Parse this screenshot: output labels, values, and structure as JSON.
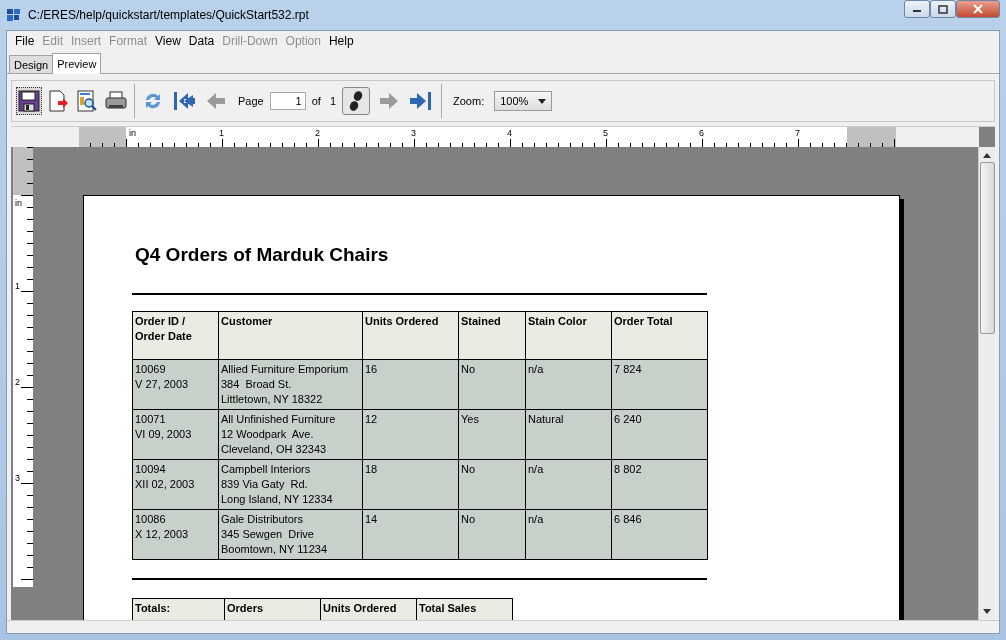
{
  "window": {
    "title": "C:/ERES/help/quickstart/templates/QuickStart532.rpt"
  },
  "menu": [
    {
      "label": "File",
      "disabled": false
    },
    {
      "label": "Edit",
      "disabled": true
    },
    {
      "label": "Insert",
      "disabled": true
    },
    {
      "label": "Format",
      "disabled": true
    },
    {
      "label": "View",
      "disabled": false
    },
    {
      "label": "Data",
      "disabled": false
    },
    {
      "label": "Drill-Down",
      "disabled": true
    },
    {
      "label": "Option",
      "disabled": true
    },
    {
      "label": "Help",
      "disabled": false
    }
  ],
  "tabs": [
    {
      "label": "Design",
      "selected": false
    },
    {
      "label": "Preview",
      "selected": true
    }
  ],
  "toolbar": {
    "nav": [
      {
        "kind": "first",
        "disabled": false
      },
      {
        "kind": "prev",
        "disabled": true
      }
    ],
    "nav_after": [
      {
        "kind": "next",
        "disabled": true
      },
      {
        "kind": "last",
        "disabled": false
      }
    ],
    "page_label": "Page",
    "page_value": "1",
    "of_label": "of",
    "page_count": "1",
    "zoom_label": "Zoom:",
    "zoom_value": "100%"
  },
  "rulers": {
    "unit_top": "in",
    "top_marks": [
      "1",
      "2",
      "3",
      "4",
      "5",
      "6",
      "7"
    ],
    "unit_left": "in",
    "left_marks": [
      "1",
      "2",
      "3"
    ]
  },
  "report": {
    "title": "Q4 Orders of Marduk Chairs",
    "columns": [
      "Order ID /\nOrder Date",
      "Customer",
      "Units Ordered",
      "Stained",
      "Stain Color",
      "Order Total"
    ],
    "rows": [
      [
        "10069\nV 27, 2003",
        "Allied Furniture Emporium\n384  Broad St.\nLittletown, NY 18322",
        "16",
        "No",
        "n/a",
        "7 824"
      ],
      [
        "10071\nVI 09, 2003",
        "All Unfinished Furniture\n12 Woodpark  Ave.\nCleveland, OH 32343",
        "12",
        "Yes",
        "Natural",
        "6 240"
      ],
      [
        "10094\nXII 02, 2003",
        "Campbell Interiors\n839 Via Gaty  Rd.\nLong Island, NY 12334",
        "18",
        "No",
        "n/a",
        "8 802"
      ],
      [
        "10086\nX 12, 2003",
        "Gale Distributors\n345 Sewgen  Drive\nBoomtown, NY 11234",
        "14",
        "No",
        "n/a",
        "6 846"
      ]
    ],
    "totals_columns": [
      "Totals:",
      "Orders",
      "Units Ordered",
      "Total Sales"
    ]
  }
}
